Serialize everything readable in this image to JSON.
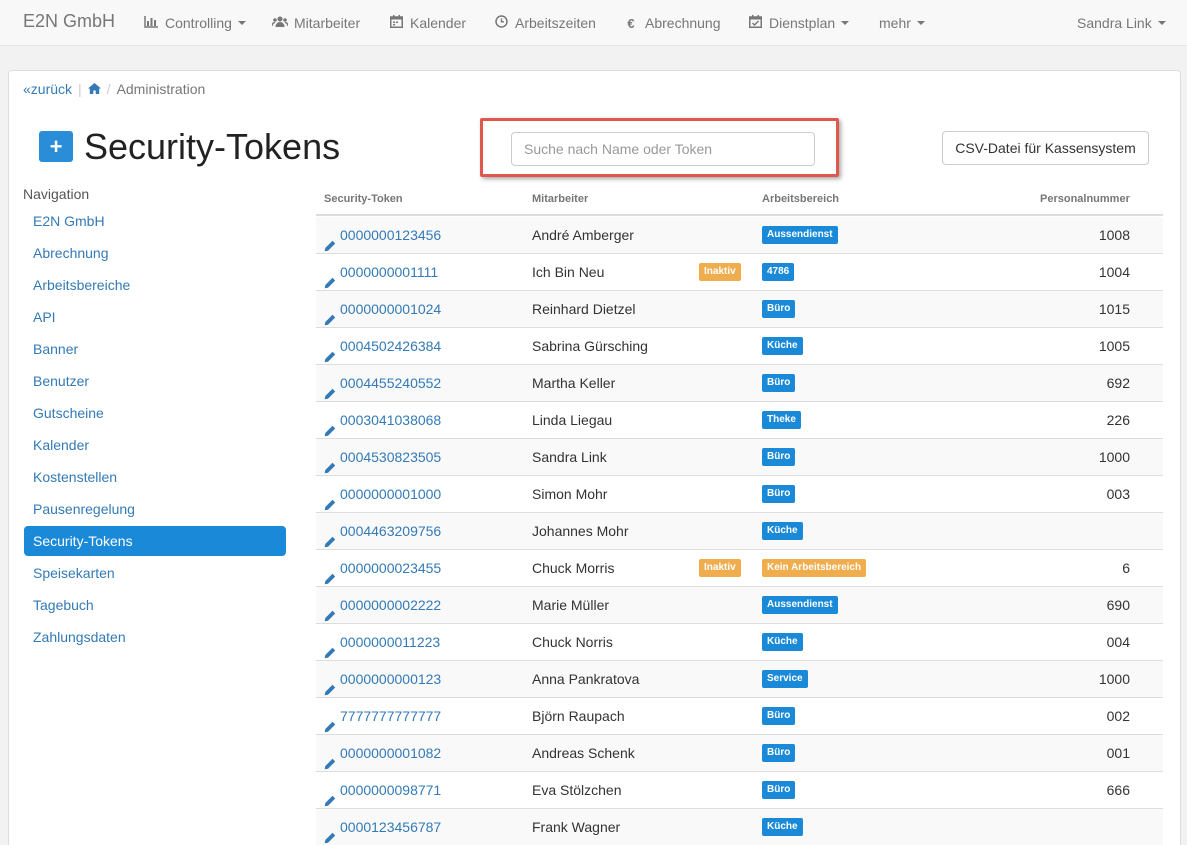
{
  "navbar": {
    "brand": "E2N GmbH",
    "items": [
      {
        "label": "Controlling",
        "icon": "bar-chart-icon",
        "dropdown": true
      },
      {
        "label": "Mitarbeiter",
        "icon": "users-icon",
        "dropdown": false
      },
      {
        "label": "Kalender",
        "icon": "calendar-icon",
        "dropdown": false
      },
      {
        "label": "Arbeitszeiten",
        "icon": "clock-icon",
        "dropdown": false
      },
      {
        "label": "Abrechnung",
        "icon": "euro-icon",
        "dropdown": false
      },
      {
        "label": "Dienstplan",
        "icon": "calendar-check-icon",
        "dropdown": true
      },
      {
        "label": "mehr",
        "icon": "",
        "dropdown": true
      }
    ],
    "user": "Sandra Link"
  },
  "breadcrumb": {
    "back": "zurück",
    "current": "Administration"
  },
  "page": {
    "title": "Security-Tokens",
    "add_label": "+"
  },
  "search": {
    "placeholder": "Suche nach Name oder Token",
    "value": ""
  },
  "csv_button": "CSV-Datei für Kassensystem",
  "sidebar": {
    "heading": "Navigation",
    "items": [
      {
        "label": "E2N GmbH",
        "active": false
      },
      {
        "label": "Abrechnung",
        "active": false
      },
      {
        "label": "Arbeitsbereiche",
        "active": false
      },
      {
        "label": "API",
        "active": false
      },
      {
        "label": "Banner",
        "active": false
      },
      {
        "label": "Benutzer",
        "active": false
      },
      {
        "label": "Gutscheine",
        "active": false
      },
      {
        "label": "Kalender",
        "active": false
      },
      {
        "label": "Kostenstellen",
        "active": false
      },
      {
        "label": "Pausenregelung",
        "active": false
      },
      {
        "label": "Security-Tokens",
        "active": true
      },
      {
        "label": "Speisekarten",
        "active": false
      },
      {
        "label": "Tagebuch",
        "active": false
      },
      {
        "label": "Zahlungsdaten",
        "active": false
      }
    ]
  },
  "table": {
    "headers": {
      "token": "Security-Token",
      "employee": "Mitarbeiter",
      "area": "Arbeitsbereich",
      "number": "Personalnummer"
    },
    "inactive_label": "Inaktiv",
    "rows": [
      {
        "token": "0000000123456",
        "name": "André Amberger",
        "area": "Aussendienst",
        "area_color": "#1a8ad8",
        "number": "1008",
        "inactive": false
      },
      {
        "token": "0000000001111",
        "name": "Ich Bin Neu",
        "area": "4786",
        "area_color": "#1a8ad8",
        "number": "1004",
        "inactive": true
      },
      {
        "token": "0000000001024",
        "name": "Reinhard Dietzel",
        "area": "Büro",
        "area_color": "#1a8ad8",
        "number": "1015",
        "inactive": false
      },
      {
        "token": "0004502426384",
        "name": "Sabrina Gürsching",
        "area": "Küche",
        "area_color": "#1a8ad8",
        "number": "1005",
        "inactive": false
      },
      {
        "token": "0004455240552",
        "name": "Martha Keller",
        "area": "Büro",
        "area_color": "#1a8ad8",
        "number": "692",
        "inactive": false
      },
      {
        "token": "0003041038068",
        "name": "Linda Liegau",
        "area": "Theke",
        "area_color": "#1a8ad8",
        "number": "226",
        "inactive": false
      },
      {
        "token": "0004530823505",
        "name": "Sandra Link",
        "area": "Büro",
        "area_color": "#1a8ad8",
        "number": "1000",
        "inactive": false
      },
      {
        "token": "0000000001000",
        "name": "Simon Mohr",
        "area": "Büro",
        "area_color": "#1a8ad8",
        "number": "003",
        "inactive": false
      },
      {
        "token": "0004463209756",
        "name": "Johannes Mohr",
        "area": "Küche",
        "area_color": "#1a8ad8",
        "number": "",
        "inactive": false
      },
      {
        "token": "0000000023455",
        "name": "Chuck Morris",
        "area": "Kein Arbeitsbereich",
        "area_color": "#f0ad4e",
        "number": "6",
        "inactive": true
      },
      {
        "token": "0000000002222",
        "name": "Marie Müller",
        "area": "Aussendienst",
        "area_color": "#1a8ad8",
        "number": "690",
        "inactive": false
      },
      {
        "token": "0000000011223",
        "name": "Chuck Norris",
        "area": "Küche",
        "area_color": "#1a8ad8",
        "number": "004",
        "inactive": false
      },
      {
        "token": "0000000000123",
        "name": "Anna Pankratova",
        "area": "Service",
        "area_color": "#1a8ad8",
        "number": "1000",
        "inactive": false
      },
      {
        "token": "7777777777777",
        "name": "Björn Raupach",
        "area": "Büro",
        "area_color": "#1a8ad8",
        "number": "002",
        "inactive": false
      },
      {
        "token": "0000000001082",
        "name": "Andreas Schenk",
        "area": "Büro",
        "area_color": "#1a8ad8",
        "number": "001",
        "inactive": false
      },
      {
        "token": "0000000098771",
        "name": "Eva Stölzchen",
        "area": "Büro",
        "area_color": "#1a8ad8",
        "number": "666",
        "inactive": false
      },
      {
        "token": "0000123456787",
        "name": "Frank Wagner",
        "area": "Küche",
        "area_color": "#1a8ad8",
        "number": "",
        "inactive": false
      }
    ]
  },
  "colors": {
    "accent": "#1a8ad8",
    "link": "#337ab7",
    "warning": "#f0ad4e",
    "highlight_border": "#e0574e"
  }
}
